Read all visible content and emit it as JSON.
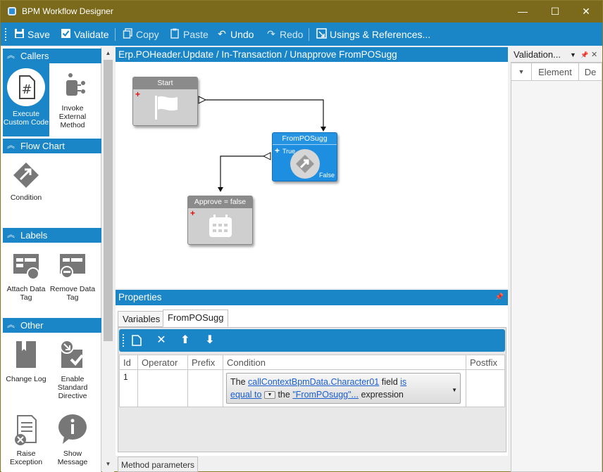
{
  "window": {
    "title": "BPM Workflow Designer",
    "minimize": "—",
    "maximize": "☐",
    "close": "✕"
  },
  "toolbar": {
    "save": "Save",
    "validate": "Validate",
    "copy": "Copy",
    "paste": "Paste",
    "undo": "Undo",
    "redo": "Redo",
    "usages": "Usings & References..."
  },
  "palette": {
    "groups": [
      {
        "name": "Callers",
        "items": [
          "Execute Custom Code",
          "Invoke External Method"
        ]
      },
      {
        "name": "Flow Chart",
        "items": [
          "Condition"
        ]
      },
      {
        "name": "Labels",
        "items": [
          "Attach Data Tag",
          "Remove Data Tag"
        ]
      },
      {
        "name": "Other",
        "items": [
          "Change Log",
          "Enable Standard Directive",
          "Raise Exception",
          "Show Message"
        ]
      }
    ]
  },
  "canvas": {
    "title": "Erp.POHeader.Update / In-Transaction / Unapprove FromPOSugg",
    "nodes": {
      "start": "Start",
      "condition": "FromPOSugg",
      "condition_true": "True",
      "condition_false": "False",
      "approve": "Approve = false"
    }
  },
  "properties": {
    "title": "Properties",
    "tabs": [
      "Variables",
      "FromPOSugg"
    ],
    "columns": [
      "Id",
      "Operator",
      "Prefix",
      "Condition",
      "Postfix"
    ],
    "row": {
      "id": "1",
      "cond_the": "The",
      "cond_field_link": "callContextBpmData.Character01",
      "cond_field_word": "field",
      "cond_op_link_1": "is",
      "cond_op_link_2": "equal to",
      "cond_the2": "the",
      "cond_value_link": "\"FromPOsugg\"...",
      "cond_expression": "expression"
    },
    "bottom_tab": "Method parameters"
  },
  "validation": {
    "title": "Validation...",
    "columns": [
      "Element",
      "De"
    ]
  },
  "colors": {
    "accent": "#1a86c8",
    "titlebar": "#7b6a1b",
    "node_blue": "#1e8fe0"
  }
}
